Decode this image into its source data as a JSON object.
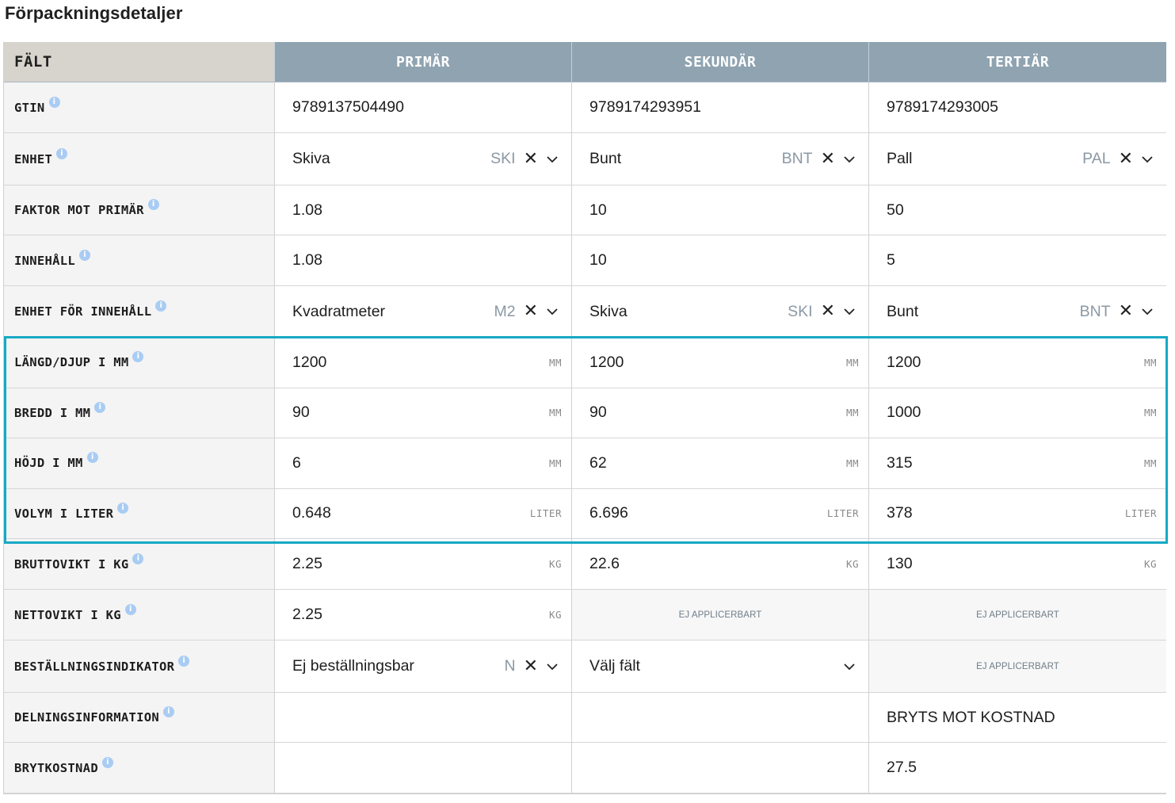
{
  "page_title": "Förpackningsdetaljer",
  "headers": {
    "field": "FÄLT",
    "primary": "PRIMÄR",
    "secondary": "SEKUNDÄR",
    "tertiary": "TERTIÄR"
  },
  "icons": {
    "info": "info-icon",
    "clear": "close-icon",
    "dropdown": "chevron-down-icon"
  },
  "colors": {
    "header_bg": "#8fa3b1",
    "field_header_bg": "#d7d3cd",
    "label_bg": "#f4f4f4",
    "highlight_border": "#16a9c4",
    "info_icon": "#a9ccf3",
    "code_text": "#8b98a4"
  },
  "info_glyph": "i",
  "clear_glyph": "✕",
  "rows": [
    {
      "label": "GTIN",
      "primary": "9789137504490",
      "secondary": "9789174293951",
      "tertiary": "9789174293005"
    },
    {
      "label": "ENHET",
      "primary": {
        "text": "Skiva",
        "code": "SKI"
      },
      "secondary": {
        "text": "Bunt",
        "code": "BNT"
      },
      "tertiary": {
        "text": "Pall",
        "code": "PAL"
      }
    },
    {
      "label": "FAKTOR MOT PRIMÄR",
      "primary": "1.08",
      "secondary": "10",
      "tertiary": "50"
    },
    {
      "label": "INNEHÅLL",
      "primary": "1.08",
      "secondary": "10",
      "tertiary": "5"
    },
    {
      "label": "ENHET FÖR INNEHÅLL",
      "primary": {
        "text": "Kvadratmeter",
        "code": "M2"
      },
      "secondary": {
        "text": "Skiva",
        "code": "SKI"
      },
      "tertiary": {
        "text": "Bunt",
        "code": "BNT"
      }
    },
    {
      "label": "LÄNGD/DJUP I MM",
      "unit": "MM",
      "primary": "1200",
      "secondary": "1200",
      "tertiary": "1200"
    },
    {
      "label": "BREDD I MM",
      "unit": "MM",
      "primary": "90",
      "secondary": "90",
      "tertiary": "1000"
    },
    {
      "label": "HÖJD I MM",
      "unit": "MM",
      "primary": "6",
      "secondary": "62",
      "tertiary": "315"
    },
    {
      "label": "VOLYM I LITER",
      "unit": "LITER",
      "primary": "0.648",
      "secondary": "6.696",
      "tertiary": "378"
    },
    {
      "label": "BRUTTOVIKT I KG",
      "unit": "KG",
      "primary": "2.25",
      "secondary": "22.6",
      "tertiary": "130"
    },
    {
      "label": "NETTOVIKT I KG",
      "unit": "KG",
      "primary": "2.25",
      "secondary": "EJ APPLICERBART",
      "tertiary": "EJ APPLICERBART"
    },
    {
      "label": "BESTÄLLNINGSINDIKATOR",
      "primary": {
        "text": "Ej beställningsbar",
        "code": "N"
      },
      "secondary": {
        "text": "Välj fält"
      },
      "tertiary": "EJ APPLICERBART"
    },
    {
      "label": "DELNINGSINFORMATION",
      "primary": "",
      "secondary": "",
      "tertiary": "BRYTS MOT KOSTNAD"
    },
    {
      "label": "BRYTKOSTNAD",
      "primary": "",
      "secondary": "",
      "tertiary": "27.5"
    }
  ]
}
